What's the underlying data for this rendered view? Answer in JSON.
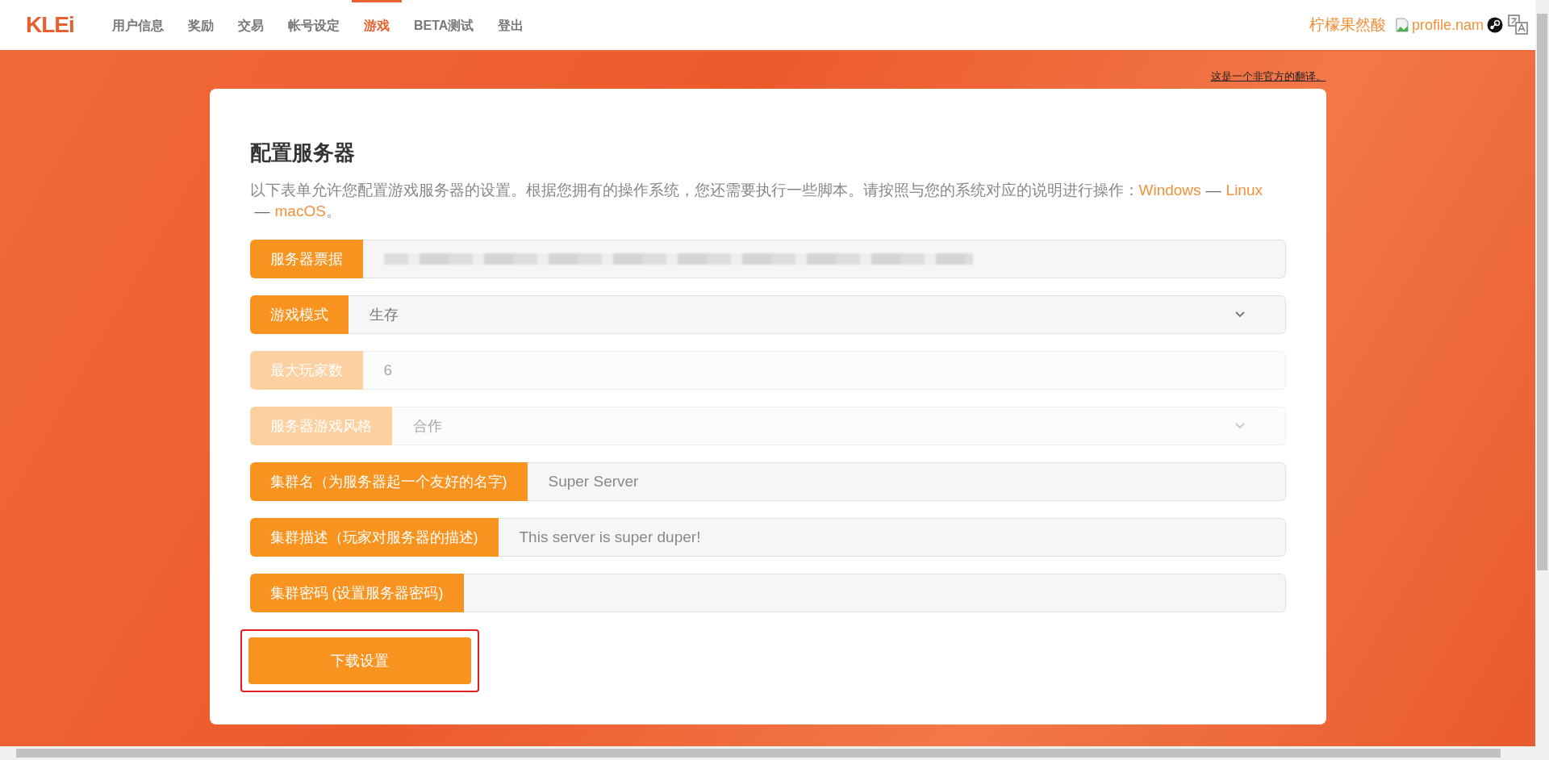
{
  "header": {
    "logo": "KLEi",
    "nav": [
      {
        "label": "用户信息",
        "selected": false
      },
      {
        "label": "奖励",
        "selected": false
      },
      {
        "label": "交易",
        "selected": false
      },
      {
        "label": "帐号设定",
        "selected": false
      },
      {
        "label": "游戏",
        "selected": true
      },
      {
        "label": "BETA测试",
        "selected": false
      },
      {
        "label": "登出",
        "selected": false
      }
    ],
    "username": "柠檬果然酸",
    "broken_image_alt": "profile.nam"
  },
  "notice_link": "这是一个非官方的翻译。",
  "form": {
    "title": "配置服务器",
    "intro": "以下表单允许您配置游戏服务器的设置。根据您拥有的操作系统，您还需要执行一些脚本。请按照与您的系统对应的说明进行操作：",
    "os_links": [
      "Windows",
      "Linux",
      "macOS"
    ],
    "link_separator": "—",
    "intro_end": "。",
    "fields": [
      {
        "kind": "secret",
        "label": "服务器票据",
        "disabled": false
      },
      {
        "kind": "select",
        "label": "游戏模式",
        "value": "生存",
        "disabled": false
      },
      {
        "kind": "text",
        "label": "最大玩家数",
        "value": "6",
        "disabled": true
      },
      {
        "kind": "select",
        "label": "服务器游戏风格",
        "value": "合作",
        "disabled": true
      },
      {
        "kind": "text",
        "label": "集群名（为服务器起一个友好的名字)",
        "placeholder": "Super Server",
        "disabled": false
      },
      {
        "kind": "text",
        "label": "集群描述（玩家对服务器的描述)",
        "placeholder": "This server is super duper!",
        "disabled": false
      },
      {
        "kind": "text",
        "label": "集群密码 (设置服务器密码)",
        "disabled": false
      }
    ],
    "submit": {
      "label": "下载设置",
      "highlighted": true
    }
  }
}
